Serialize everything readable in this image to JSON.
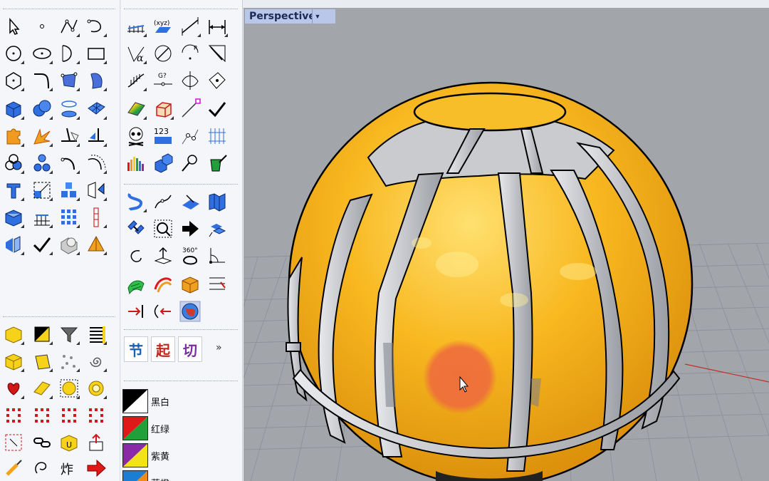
{
  "viewport": {
    "title": "Perspective",
    "menu_icon": "dropdown-arrow-icon"
  },
  "toolbar_more": "»",
  "command_buttons": [
    {
      "label": "节",
      "color": "#1a5fb0"
    },
    {
      "label": "起",
      "color": "#c0261f"
    },
    {
      "label": "切",
      "color": "#7a2fa0"
    }
  ],
  "display_modes": [
    {
      "label": "黑白",
      "colors": [
        "#000000",
        "#ffffff"
      ]
    },
    {
      "label": "红绿",
      "colors": [
        "#e01818",
        "#1fa03a"
      ]
    },
    {
      "label": "紫黄",
      "colors": [
        "#8a2aa8",
        "#f3e21a"
      ]
    },
    {
      "label": "蓝橙",
      "colors": [
        "#1a7fd4",
        "#f08a18"
      ]
    }
  ],
  "model": {
    "surface_color": "#f6b21c",
    "frame_color": "#b9bcc2"
  },
  "cursor_highlight_color": "#ee6d3c"
}
